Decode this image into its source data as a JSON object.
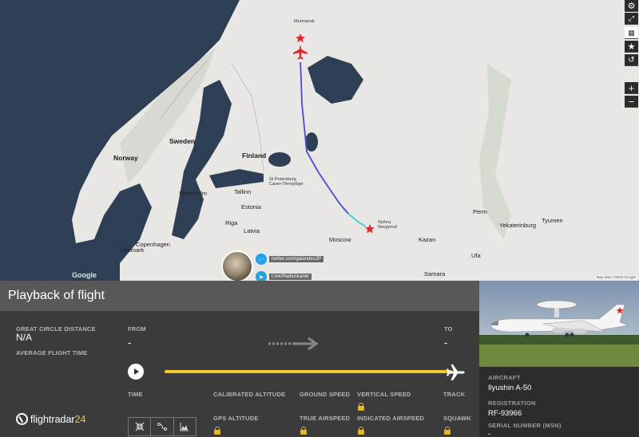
{
  "map": {
    "labels": {
      "sweden": "Sweden",
      "norway": "Norway",
      "finland": "Finland",
      "stockholm": "Stockholm",
      "tallinn": "Tallinn",
      "estonia": "Estonia",
      "latvia": "Latvia",
      "riga": "Riga",
      "copenhagen": "Copenhagen",
      "denmark": "Denmark",
      "st_petersburg": "St Petersburg\nСанкт-Петербург",
      "moscow": "Moscow",
      "nizhny": "Nizhny\nNovgorod",
      "kazan": "Kazan",
      "yekaterinburg": "Yekaterinburg",
      "tyumen": "Tyumen",
      "perm": "Perm",
      "murmansk": "Murmansk",
      "samara": "Samara",
      "ufa": "Ufa"
    },
    "google_logo": "Google",
    "attribution": "Map data ©2023 Google"
  },
  "social": {
    "twitter": "twitter.com/galandec2P",
    "telegram": "t.me/Radioskaner"
  },
  "panel": {
    "title": "Playback of flight",
    "great_circle_distance_label": "GREAT CIRCLE DISTANCE",
    "great_circle_distance_value": "N/A",
    "average_flight_time_label": "AVERAGE FLIGHT TIME",
    "from_label": "FROM",
    "from_value": "-",
    "to_label": "TO",
    "to_value": "-",
    "progress": 1.0,
    "fields": {
      "time": "TIME",
      "calibrated_altitude": "CALIBRATED ALTITUDE",
      "ground_speed": "GROUND SPEED",
      "vertical_speed": "VERTICAL SPEED",
      "track": "TRACK",
      "gps_altitude": "GPS ALTITUDE",
      "true_airspeed": "TRUE AIRSPEED",
      "indicated_airspeed": "INDICATED AIRSPEED",
      "squawk": "SQUAWK"
    },
    "logo": {
      "main": "flightradar",
      "suffix": "24"
    }
  },
  "aircraft": {
    "aircraft_label": "AIRCRAFT",
    "aircraft_value": "Ilyushin A-50",
    "registration_label": "REGISTRATION",
    "registration_value": "RF-93966",
    "serial_label": "SERIAL NUMBER (MSN)",
    "serial_value": "-"
  },
  "colors": {
    "accent_yellow": "#f2c42e",
    "track_blue": "#4b4bd6",
    "track_cyan": "#48c8d8",
    "marker_red": "#e0282d"
  },
  "icons": [
    "gear-icon",
    "fullscreen-icon",
    "filter-icon",
    "star-icon",
    "history-icon",
    "zoom-in-icon",
    "zoom-out-icon",
    "play-icon",
    "arrow-right-icon",
    "airplane-icon",
    "lock-icon"
  ]
}
